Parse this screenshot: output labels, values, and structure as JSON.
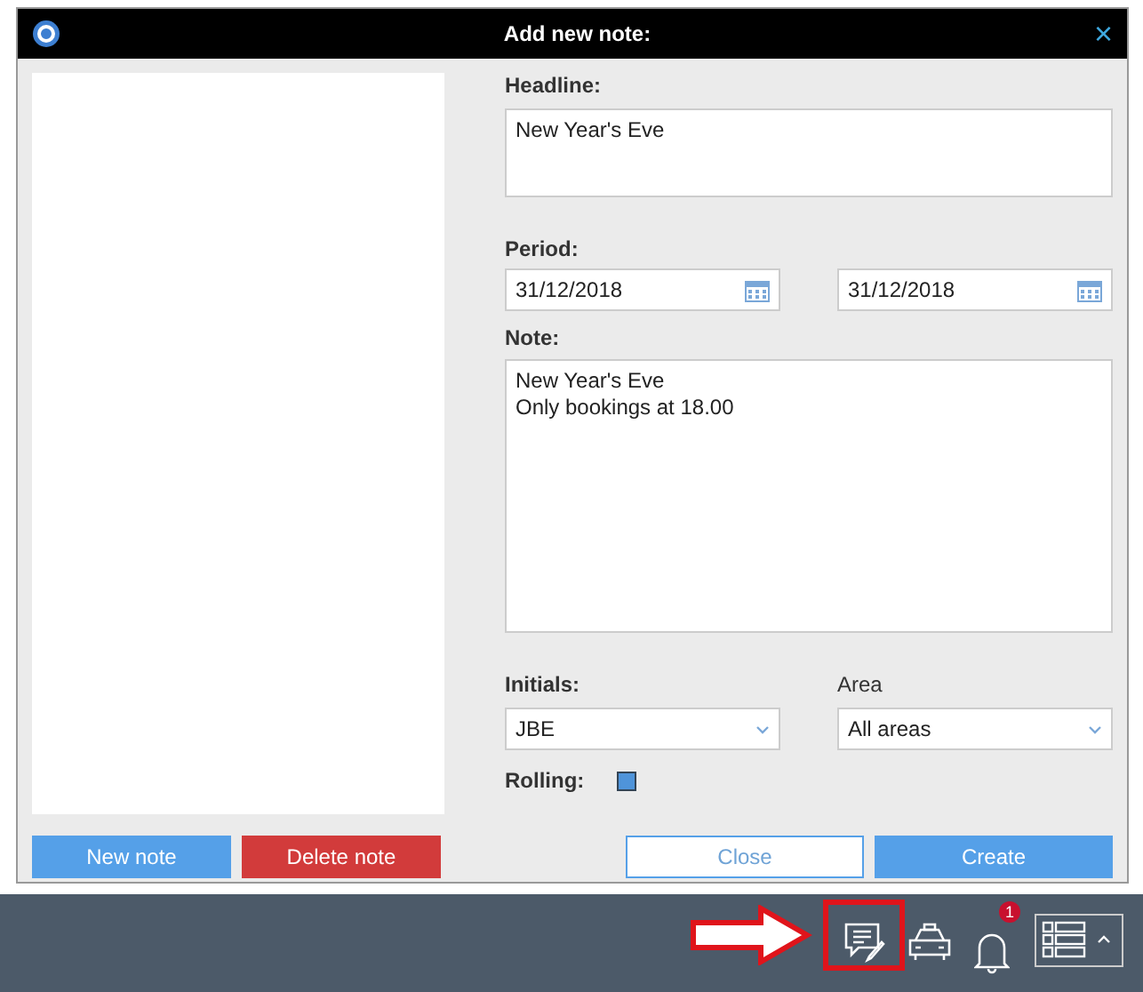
{
  "window": {
    "title": "Add new note:",
    "close": "×"
  },
  "notes_panel": {
    "buttons": [
      {
        "label": "New note",
        "kind": "primary"
      },
      {
        "label": "Delete note",
        "kind": "danger"
      }
    ]
  },
  "form": {
    "headline": {
      "label": "Headline:",
      "value": "New Year's Eve"
    },
    "period": {
      "label": "Period:",
      "from": "31/12/2018",
      "to": "31/12/2018"
    },
    "note": {
      "label": "Note:",
      "lines": [
        "New Year's Eve",
        "Only bookings at 18.00"
      ]
    },
    "initials": {
      "label": "Initials:",
      "value": "JBE"
    },
    "area": {
      "label": "Area",
      "value": "All areas"
    },
    "rolling": {
      "label": "Rolling:",
      "checked": true
    },
    "buttons": [
      {
        "label": "Close",
        "kind": "secondary"
      },
      {
        "label": "Create",
        "kind": "primary"
      }
    ]
  },
  "taskbar": {
    "notification_count": "1",
    "highlighted": true
  }
}
